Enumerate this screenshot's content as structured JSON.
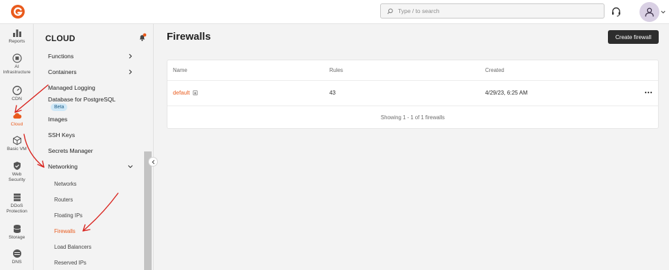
{
  "topbar": {
    "search_placeholder": "Type / to search"
  },
  "rail": {
    "items": [
      {
        "label": "Reports",
        "icon": "bar-chart-icon"
      },
      {
        "label": "AI\nInfrastructure",
        "icon": "chip-icon"
      },
      {
        "label": "CDN",
        "icon": "gauge-icon"
      },
      {
        "label": "Cloud",
        "icon": "cloud-icon",
        "active": true
      },
      {
        "label": "Basic VM",
        "icon": "cube-icon"
      },
      {
        "label": "Web\nSecurity",
        "icon": "shield-check-icon"
      },
      {
        "label": "DDoS\nProtection",
        "icon": "layers-icon"
      },
      {
        "label": "Storage",
        "icon": "database-icon"
      },
      {
        "label": "DNS",
        "icon": "dns-icon"
      }
    ]
  },
  "subnav": {
    "title": "CLOUD",
    "items": [
      {
        "label": "Functions"
      },
      {
        "label": "Containers"
      },
      {
        "label": "Managed Logging"
      },
      {
        "label": "Database for PostgreSQL",
        "badge": "Beta"
      },
      {
        "label": "Images"
      },
      {
        "label": "SSH Keys"
      },
      {
        "label": "Secrets Manager"
      },
      {
        "label": "Networking"
      }
    ],
    "networking_children": [
      {
        "label": "Networks"
      },
      {
        "label": "Routers"
      },
      {
        "label": "Floating IPs"
      },
      {
        "label": "Firewalls"
      },
      {
        "label": "Load Balancers"
      },
      {
        "label": "Reserved IPs"
      }
    ]
  },
  "main": {
    "title": "Firewalls",
    "create_label": "Create firewall",
    "table": {
      "headers": [
        "Name",
        "Rules",
        "Created"
      ],
      "rows": [
        {
          "name": "default",
          "rules": "43",
          "created": "4/29/23, 6:25 AM"
        }
      ],
      "footer": "Showing 1 - 1 of 1 firewalls"
    }
  },
  "colors": {
    "accent": "#e95a1c",
    "annotation": "#d9231d",
    "button_dark": "#2d2d2d",
    "beta_bg": "#cfe8f7"
  }
}
